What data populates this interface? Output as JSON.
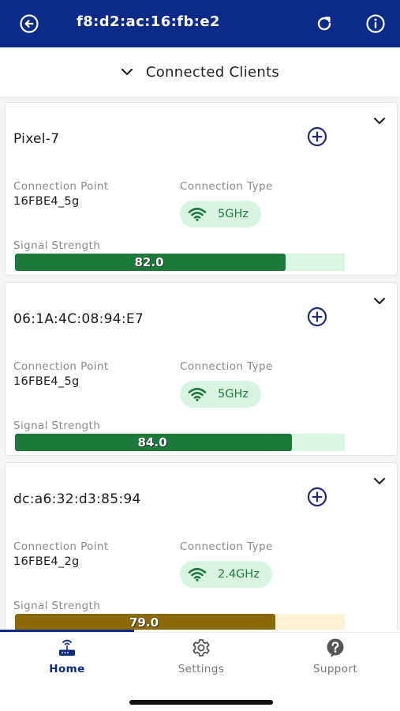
{
  "header": {
    "title": "f8:d2:ac:16:fb:e2",
    "back_icon": "back-circle-icon",
    "refresh_icon": "refresh-icon",
    "info_icon": "info-icon",
    "background_color": "#0b2a8a"
  },
  "section": {
    "title": "Connected Clients",
    "chevron_icon": "chevron-down-icon"
  },
  "labels": {
    "connection_point": "Connection Point",
    "connection_type": "Connection Type",
    "signal_strength": "Signal Strength"
  },
  "clients": [
    {
      "name": "Pixel-7",
      "connection_point": "16FBE4_5g",
      "connection_type": "5GHz",
      "signal_strength": "82.0",
      "signal_fraction": 0.82,
      "bar_color": "#1b7a3a",
      "track_color": "#dcf6e4"
    },
    {
      "name": "06:1A:4C:08:94:E7",
      "connection_point": "16FBE4_5g",
      "connection_type": "5GHz",
      "signal_strength": "84.0",
      "signal_fraction": 0.84,
      "bar_color": "#1b7a3a",
      "track_color": "#dcf6e4"
    },
    {
      "name": "dc:a6:32:d3:85:94",
      "connection_point": "16FBE4_2g",
      "connection_type": "2.4GHz",
      "signal_strength": "79.0",
      "signal_fraction": 0.79,
      "bar_color": "#8b6a06",
      "track_color": "#fdf2d6"
    }
  ],
  "nav": {
    "items": [
      {
        "label": "Home",
        "icon": "router-icon",
        "active": true
      },
      {
        "label": "Settings",
        "icon": "gear-icon",
        "active": false
      },
      {
        "label": "Support",
        "icon": "help-circle-icon",
        "active": false
      }
    ],
    "active_color": "#0b2a8a",
    "inactive_color": "#777777"
  }
}
